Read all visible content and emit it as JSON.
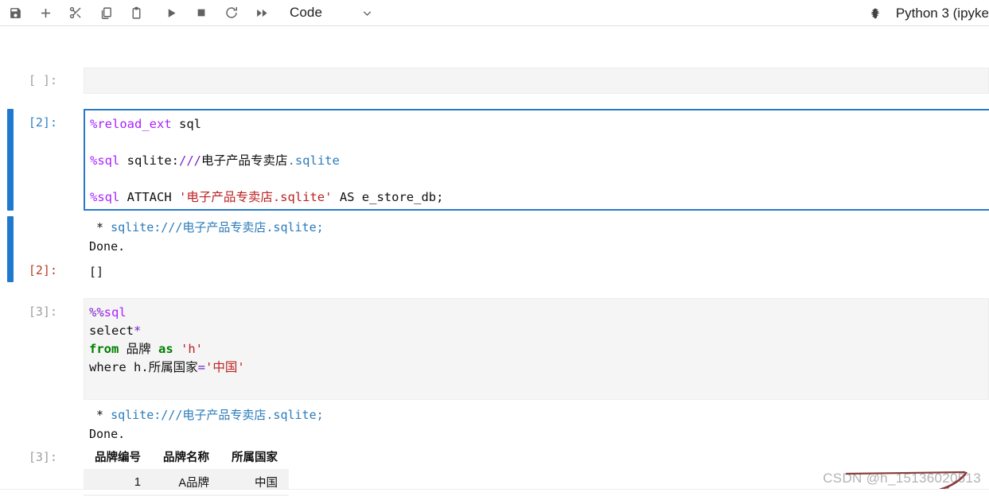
{
  "toolbar": {
    "buttons": [
      {
        "name": "save-button",
        "icon": "save-icon",
        "title": "Save"
      },
      {
        "name": "insert-cell-button",
        "icon": "plus-icon",
        "title": "Insert cell below"
      },
      {
        "name": "cut-button",
        "icon": "scissors-icon",
        "title": "Cut"
      },
      {
        "name": "copy-button",
        "icon": "copy-icon",
        "title": "Copy"
      },
      {
        "name": "paste-button",
        "icon": "paste-icon",
        "title": "Paste"
      },
      {
        "name": "run-button",
        "icon": "play-icon",
        "title": "Run"
      },
      {
        "name": "stop-button",
        "icon": "stop-square-icon",
        "title": "Interrupt kernel"
      },
      {
        "name": "restart-button",
        "icon": "restart-icon",
        "title": "Restart kernel"
      },
      {
        "name": "restart-run-all-button",
        "icon": "fast-forward-icon",
        "title": "Restart and run all"
      }
    ],
    "cell_type": "Code",
    "cell_type_caret": "chevron-down-icon",
    "kernel_name": "Python 3 (ipyke",
    "debugger_icon": "bug-icon"
  },
  "cells": [
    {
      "prompt": "[ ]:",
      "prompt_style": "idle",
      "selected": false,
      "source": []
    },
    {
      "prompt": "[2]:",
      "prompt_style": "blue",
      "selected": true,
      "source_lines": [
        "%reload_ext sql",
        "",
        "%sql sqlite:///电子产品专卖店.sqlite",
        "",
        "%sql ATTACH '电子产品专卖店.sqlite' AS e_store_db;"
      ],
      "outputs": [
        {
          "type": "stream",
          "lines": [
            " * sqlite:///电子产品专卖店.sqlite;",
            "Done."
          ]
        },
        {
          "type": "result",
          "prompt": "[2]:",
          "prompt_style": "out",
          "text": "[]"
        }
      ]
    },
    {
      "prompt": "[3]:",
      "prompt_style": "idle",
      "selected": false,
      "source_lines": [
        "%%sql",
        "select*",
        "from 品牌 as 'h'",
        "where h.所属国家='中国'"
      ],
      "outputs": [
        {
          "type": "stream",
          "lines": [
            " * sqlite:///电子产品专卖店.sqlite;",
            "Done."
          ]
        },
        {
          "type": "table",
          "prompt": "[3]:",
          "prompt_style": "idle",
          "headers": [
            "品牌编号",
            "品牌名称",
            "所属国家"
          ],
          "rows": [
            [
              "1",
              "A品牌",
              "中国"
            ]
          ]
        }
      ]
    }
  ],
  "code_tokens": {
    "c2_l1_magic": "%reload_ext",
    "c2_l1_rest": " sql",
    "c2_l3_magic": "%sql",
    "c2_l3_a": " sqlite:",
    "c2_l3_slashes": "///",
    "c2_l3_name": "电子产品专卖店",
    "c2_l3_ext": ".sqlite",
    "c2_l5_magic": "%sql",
    "c2_l5_attach": " ATTACH ",
    "c2_l5_str": "'电子产品专卖店.sqlite'",
    "c2_l5_as": " AS e_store_db;",
    "c3_l1_magic": "%%",
    "c3_l1_sql": "sql",
    "c3_l2_select": "select",
    "c3_l2_star": "*",
    "c3_l3_from": "from",
    "c3_l3_tbl": " 品牌 ",
    "c3_l3_as": "as",
    "c3_l3_alias": " 'h'",
    "c3_l4_where": "where h.所属国家",
    "c3_l4_eq": "=",
    "c3_l4_str": "'中国'"
  },
  "outputs_text": {
    "star_prefix": " * ",
    "conn_url": "sqlite:///电子产品专卖店.sqlite;",
    "done": "Done.",
    "empty_list": "[]"
  },
  "watermark": {
    "text": "CSDN @h_15136020513",
    "color": "#b3b3b3"
  },
  "colors": {
    "selection_bar": "#1f79cf",
    "active_cell_border": "#2979c8",
    "code_background": "#f5f5f5",
    "prompt_blue": "#307fc1",
    "prompt_out_red": "#ba3b26",
    "prompt_idle_gray": "#9e9e9e",
    "magic_purple": "#aa22ff",
    "string_red": "#bb2222",
    "keyword_green": "#008000",
    "link_blue": "#2b7bba",
    "annotation_red": "#8a3b3b"
  }
}
